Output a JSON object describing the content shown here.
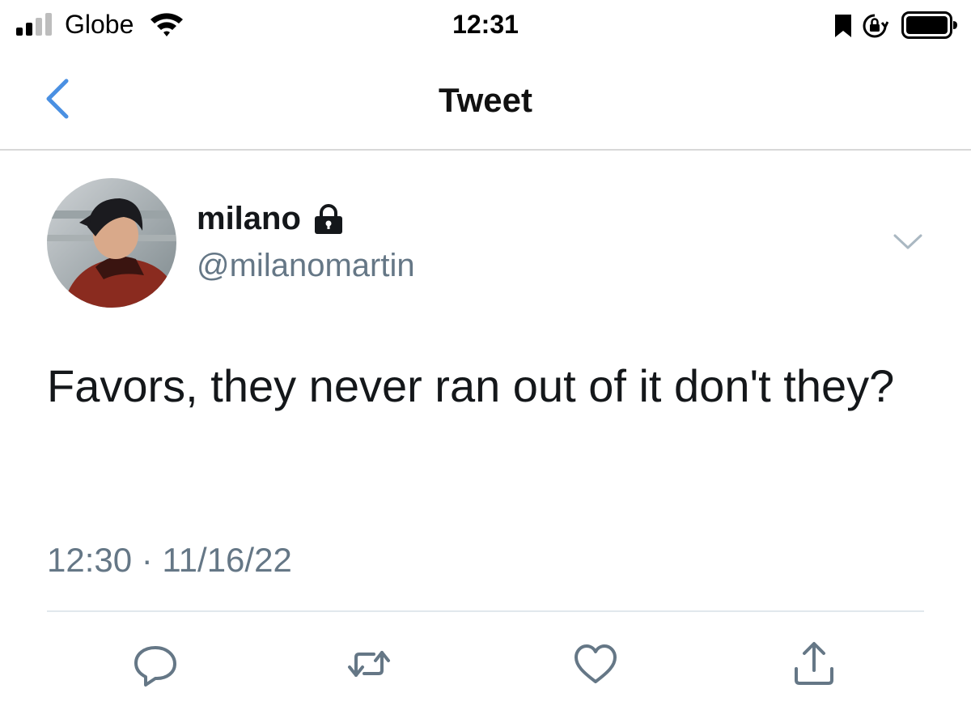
{
  "status_bar": {
    "carrier": "Globe",
    "time": "12:31",
    "signal_icon": "signal-bars-icon",
    "wifi_icon": "wifi-icon",
    "bookmark_icon": "bookmark-icon",
    "rotation_lock_icon": "rotation-lock-icon",
    "battery_icon": "battery-icon"
  },
  "nav": {
    "title": "Tweet",
    "back_icon": "chevron-left-icon",
    "accent_color": "#4a90e2"
  },
  "tweet": {
    "display_name": "milano",
    "handle": "@milanomartin",
    "protected_icon": "lock-icon",
    "more_icon": "chevron-down-icon",
    "text": "Favors, they never ran out of it don't they?",
    "timestamp": "12:30 · 11/16/22"
  },
  "actions": {
    "reply_icon": "reply-icon",
    "retweet_icon": "retweet-icon",
    "like_icon": "heart-icon",
    "share_icon": "share-icon",
    "icon_color": "#657786"
  }
}
